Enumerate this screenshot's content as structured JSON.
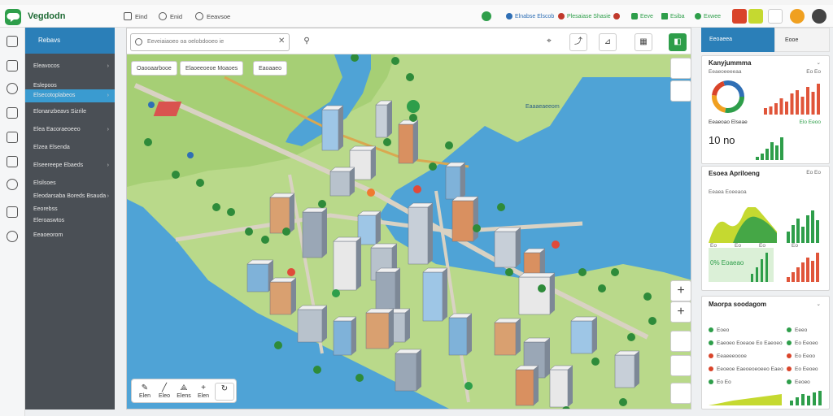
{
  "app": {
    "name": "Vegdodn"
  },
  "header": {
    "items": [
      {
        "label": "Eind",
        "icon": "grid-icon"
      },
      {
        "label": "Enid",
        "icon": "edit-icon"
      },
      {
        "label": "Eeavsoe",
        "icon": "settings-icon"
      }
    ],
    "statuses": [
      {
        "label": "Elnabse Elscob",
        "color": "#2f6fb5"
      },
      {
        "label": "Plesaiase Shasie",
        "color": "#2e9e4a"
      },
      {
        "label": "Eeve",
        "color": "#2e9e4a"
      },
      {
        "label": "Esiba",
        "color": "#2e9e4a"
      },
      {
        "label": "Exwee",
        "color": "#2e9e4a"
      }
    ]
  },
  "sidebar": {
    "title": "Rebavs",
    "items": [
      {
        "label": "Eleavocos",
        "active": false
      },
      {
        "label": "Eslepoos",
        "active": false
      },
      {
        "label": "Elsecotoplabeos",
        "active": true
      },
      {
        "label": "Elonanzbeavs Sizrile",
        "active": false
      },
      {
        "label": "Elea Eacoraeoeeo",
        "active": false
      },
      {
        "label": "Elzea Elsenda",
        "active": false
      },
      {
        "label": "Elseereepe Ebaeds",
        "active": false
      },
      {
        "label": "Elsilsoes",
        "active": false
      },
      {
        "label": "Eleodarsaba Boreds Bsauda",
        "active": false
      },
      {
        "label": "Eeorebss",
        "active": false
      },
      {
        "label": "Eleroaswtos",
        "active": false
      },
      {
        "label": "Eeaoeorom",
        "active": false
      }
    ]
  },
  "map": {
    "search_placeholder": "Eeveiaiaoeo oa oelobdooeo ie",
    "chips": [
      "Oaooaarbooe",
      "Elaoeeoeoe Moaoes",
      "Eaoaaeo"
    ],
    "water_label": "Eaaaeaeeom",
    "tools": [
      "Elen",
      "Eleo",
      "Elens",
      "Elen",
      ""
    ]
  },
  "right": {
    "tabs": [
      "Eeoaeea",
      "Eooe"
    ],
    "card1": {
      "title": "Kanyjummma",
      "subtitle": "Eeaeoeeeeaa",
      "stat_label": "Eeaeoao Elseae",
      "stat_trend": "Elo Eeoo",
      "value": "10 no",
      "corner": "Eo Eo"
    },
    "card2": {
      "title": "Esoea Apriloeng",
      "subtitle": "Eeaea Eoeeaoa",
      "corner": "Eo Eo",
      "x_labels": [
        "Eo",
        "Eo",
        "Eo",
        "Eo"
      ],
      "green_label": "0% Eoaeao"
    },
    "card3": {
      "title": "Maorpa soodagom",
      "legend": [
        {
          "label": "Eoeo",
          "value": "Eeeo",
          "color": "#2e9e4a"
        },
        {
          "label": "Eaeoeo Eoeaoe Eo Eaeoeo",
          "value": "Eo Eeoeo",
          "color": "#2e9e4a"
        },
        {
          "label": "Eeaeeeoooe",
          "value": "Eo Eeoo",
          "color": "#d9442a"
        },
        {
          "label": "Eeoeoe Eaeoeoeoeeo Eaeo",
          "value": "Eo Eeoeo",
          "color": "#d9442a"
        },
        {
          "label": "Eo Eo",
          "value": "Eeoeo",
          "color": "#2e9e4a"
        }
      ]
    }
  },
  "colors": {
    "accent": "#2b7fb8",
    "brand": "#2e9e4a",
    "sidebar": "#4a4f55"
  }
}
